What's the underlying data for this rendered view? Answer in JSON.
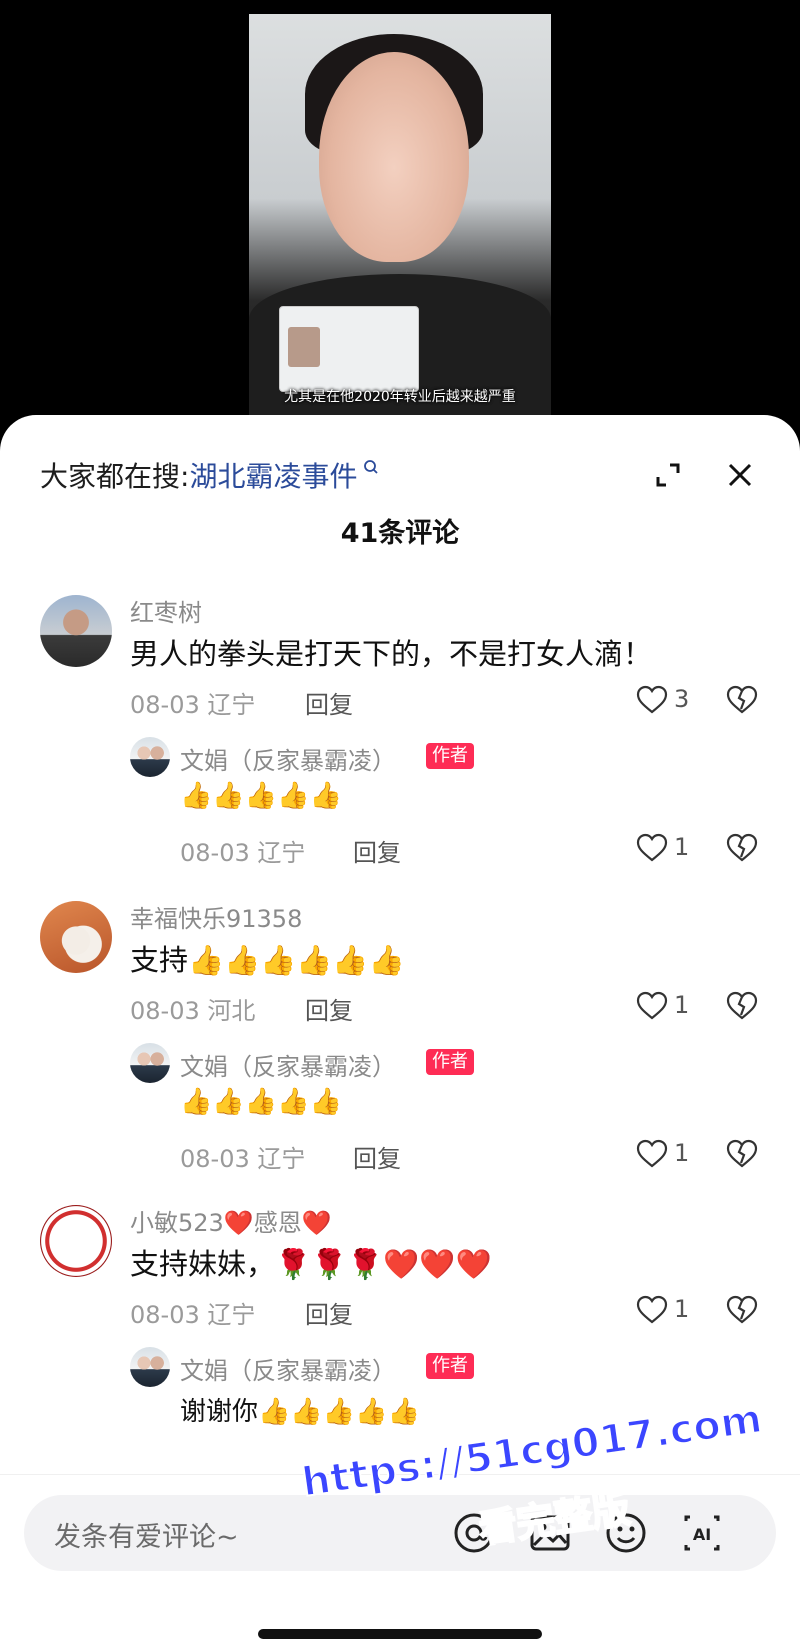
{
  "video": {
    "subtitle": "尤其是在他2020年转业后越来越严重"
  },
  "header": {
    "search_prefix": "大家都在搜:",
    "search_link": "湖北霸凌事件",
    "comment_count": "41条评论"
  },
  "comments": [
    {
      "name": "红枣树",
      "content": "男人的拳头是打天下的，不是打女人滴！",
      "meta": "08-03 辽宁",
      "reply": "回复",
      "likes": "3",
      "reply_item": {
        "name": "文娟（反家暴霸凌）",
        "badge": "作者",
        "content": "👍👍👍👍👍",
        "meta": "08-03 辽宁",
        "reply": "回复",
        "likes": "1"
      }
    },
    {
      "name": "幸福快乐91358",
      "content": "支持👍👍👍👍👍👍",
      "meta": "08-03 河北",
      "reply": "回复",
      "likes": "1",
      "reply_item": {
        "name": "文娟（反家暴霸凌）",
        "badge": "作者",
        "content": "👍👍👍👍👍",
        "meta": "08-03 辽宁",
        "reply": "回复",
        "likes": "1"
      }
    },
    {
      "name": "小敏523❤️感恩❤️",
      "content": "支持妹妹，🌹🌹🌹❤️❤️❤️",
      "meta": "08-03 辽宁",
      "reply": "回复",
      "likes": "1",
      "reply_item": {
        "name": "文娟（反家暴霸凌）",
        "badge": "作者",
        "content": "谢谢你👍👍👍👍👍"
      }
    }
  ],
  "input": {
    "placeholder": "发条有爱评论~"
  },
  "watermark": {
    "line1": "https://51cg017.com",
    "line2": "看完整版"
  },
  "icons": {
    "search": "search-icon",
    "expand": "expand-icon",
    "close": "close-icon",
    "like": "heart-icon",
    "dislike": "broken-heart-icon",
    "mention": "at-icon",
    "image": "image-icon",
    "emoji": "emoji-icon",
    "ai": "ai-icon"
  }
}
